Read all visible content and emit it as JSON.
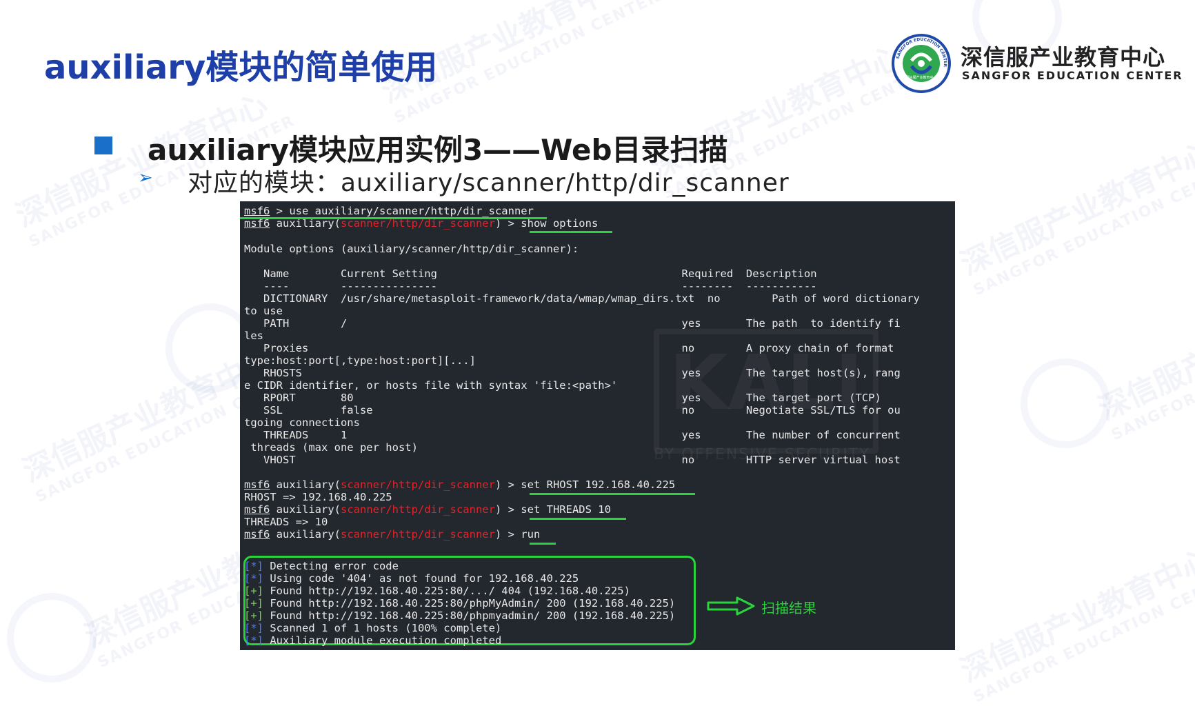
{
  "title": "auxiliary模块的简单使用",
  "logo": {
    "cn": "深信服产业教育中心",
    "en": "SANGFOR EDUCATION CENTER",
    "ring_text": "SANGFOR EDUCATION CENTER",
    "inner_text": "深信服产业教育中心"
  },
  "watermark": {
    "cn": "深信服产业教育中心",
    "en": "SANGFOR EDUCATION CENTER"
  },
  "heading": "auxiliary模块应用实例3——Web目录扫描",
  "subline": "对应的模块：auxiliary/scanner/http/dir_scanner",
  "terminal": {
    "bg_logo": "KALI",
    "bg_logo_sub": "BY OFFENSIVE SECURITY",
    "prompt": "msf6",
    "prompt_aux": "auxiliary(",
    "module_path": "scanner/http/dir_scanner",
    "cmd_use": "use auxiliary/scanner/http/dir_scanner",
    "cmd_show": "show options",
    "module_options_header": "Module options (auxiliary/scanner/http/dir_scanner):",
    "table_header": "   Name        Current Setting                                      Required  Description",
    "table_rule": "   ----        ---------------                                      --------  -----------",
    "rows": [
      "   DICTIONARY  /usr/share/metasploit-framework/data/wmap/wmap_dirs.txt  no        Path of word dictionary",
      "to use",
      "   PATH        /                                                    yes       The path  to identify fi",
      "les",
      "   Proxies                                                          no        A proxy chain of format",
      "type:host:port[,type:host:port][...]",
      "   RHOSTS                                                           yes       The target host(s), rang",
      "e CIDR identifier, or hosts file with syntax 'file:<path>'",
      "   RPORT       80                                                   yes       The target port (TCP)",
      "   SSL         false                                                no        Negotiate SSL/TLS for ou",
      "tgoing connections",
      "   THREADS     1                                                    yes       The number of concurrent",
      " threads (max one per host)",
      "   VHOST                                                            no        HTTP server virtual host"
    ],
    "cmd_rhost": "set RHOST 192.168.40.225",
    "out_rhost": "RHOST => 192.168.40.225",
    "cmd_threads": "set THREADS 10",
    "out_threads": "THREADS => 10",
    "cmd_run": "run",
    "results": [
      {
        "tag": "[*]",
        "text": " Detecting error code"
      },
      {
        "tag": "[*]",
        "text": " Using code '404' as not found for 192.168.40.225"
      },
      {
        "tag": "[+]",
        "text": " Found http://192.168.40.225:80/.../ 404 (192.168.40.225)"
      },
      {
        "tag": "[+]",
        "text": " Found http://192.168.40.225:80/phpMyAdmin/ 200 (192.168.40.225)"
      },
      {
        "tag": "[+]",
        "text": " Found http://192.168.40.225:80/phpmyadmin/ 200 (192.168.40.225)"
      },
      {
        "tag": "[*]",
        "text": " Scanned 1 of 1 hosts (100% complete)"
      },
      {
        "tag": "[*]",
        "text": " Auxiliary module execution completed"
      }
    ]
  },
  "annotation": "扫描结果",
  "colors": {
    "title": "#1f3fa8",
    "bullet": "#1a6fc9",
    "terminal_bg": "#23272e",
    "highlight_green": "#2bd33d",
    "module_red": "#e3242b",
    "status_blue": "#4c7dff"
  }
}
